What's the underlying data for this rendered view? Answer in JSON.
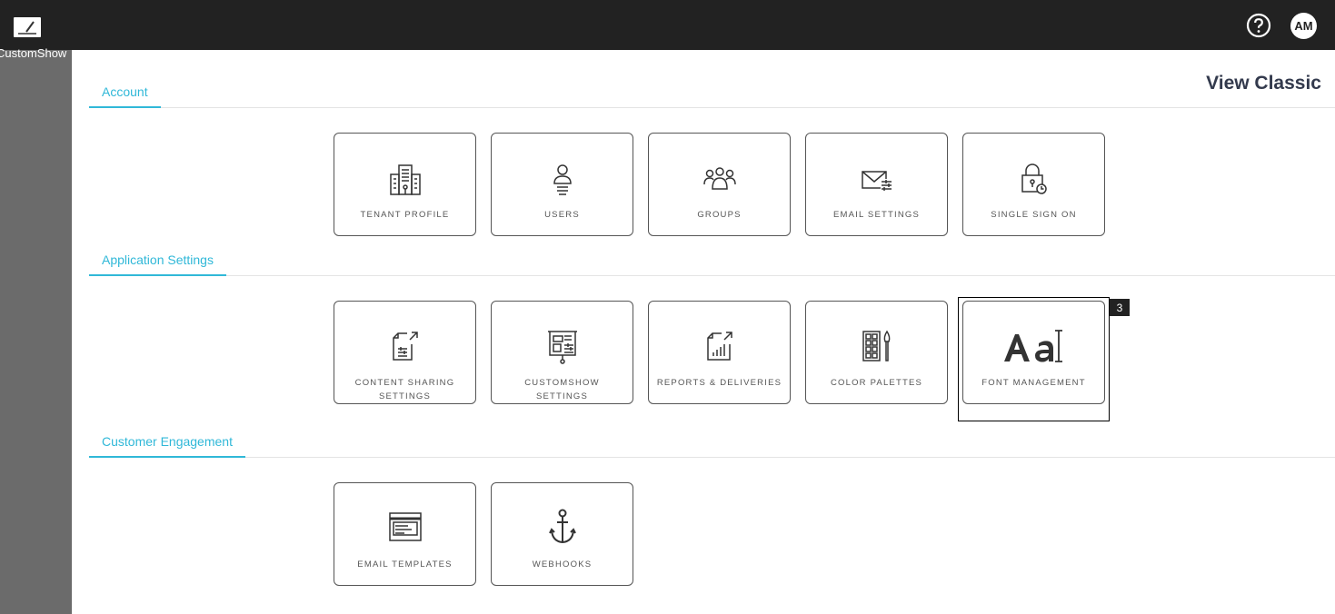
{
  "app": {
    "name": "CustomShow",
    "avatar_initials": "AM"
  },
  "header": {
    "view_classic": "View Classic"
  },
  "sections": [
    {
      "title": "Account",
      "cards": [
        {
          "label": "TENANT PROFILE",
          "icon": "building-icon"
        },
        {
          "label": "USERS",
          "icon": "user-icon"
        },
        {
          "label": "GROUPS",
          "icon": "group-icon"
        },
        {
          "label": "EMAIL SETTINGS",
          "icon": "email-settings-icon"
        },
        {
          "label": "SINGLE SIGN ON",
          "icon": "lock-icon"
        }
      ]
    },
    {
      "title": "Application Settings",
      "cards": [
        {
          "label": "CONTENT SHARING SETTINGS",
          "icon": "document-share-icon"
        },
        {
          "label": "CUSTOMSHOW SETTINGS",
          "icon": "presentation-board-icon"
        },
        {
          "label": "REPORTS & DELIVERIES",
          "icon": "report-chart-icon"
        },
        {
          "label": "COLOR PALETTES",
          "icon": "palette-brush-icon"
        },
        {
          "label": "FONT MANAGEMENT",
          "icon": "font-aa-icon"
        }
      ]
    },
    {
      "title": "Customer Engagement",
      "cards": [
        {
          "label": "EMAIL TEMPLATES",
          "icon": "email-template-icon"
        },
        {
          "label": "WEBHOOKS",
          "icon": "anchor-icon"
        }
      ]
    }
  ],
  "annotation": {
    "badge": "3"
  }
}
